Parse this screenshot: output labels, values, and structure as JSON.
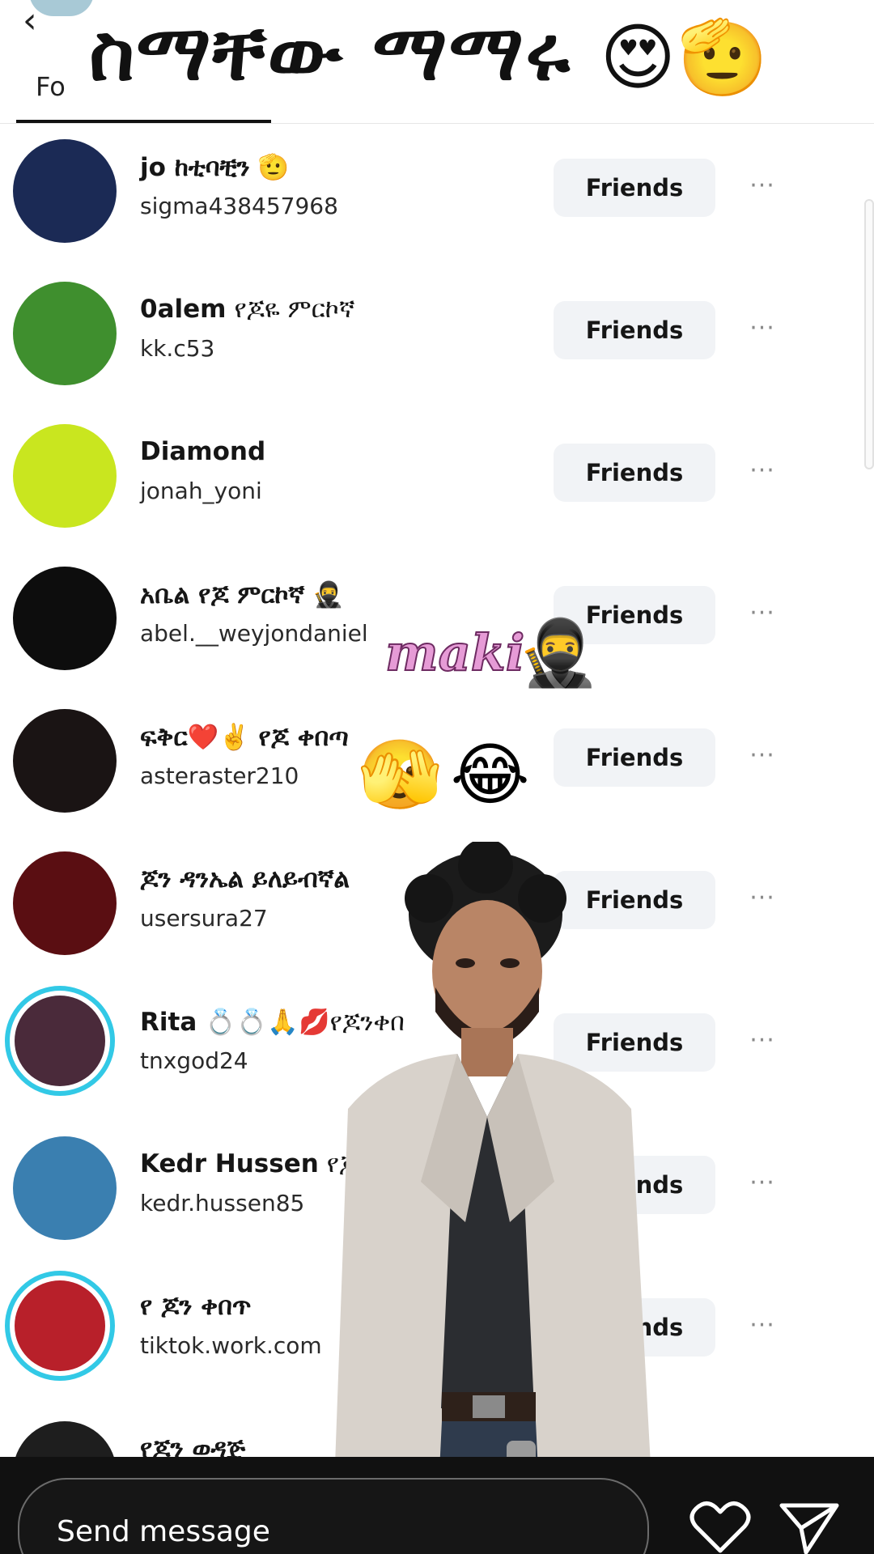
{
  "header": {
    "tab_label": "Fo",
    "overlay_title": "ስማቸው ማማሩ",
    "title_emojis": "😍🫡"
  },
  "overlays": {
    "maki_text": "maki",
    "maki_emoji": "🥷",
    "reaction_emojis": "🫣😂"
  },
  "friend_button_label": "Friends",
  "more_label": "···",
  "friends": [
    {
      "name": "jo ከቲባቺን",
      "emoji": "🫡",
      "username": "sigma438457968",
      "avatar_color": "#1b2a55",
      "ring": false
    },
    {
      "name": "0alem",
      "suffix": "የጆዬ ምርኮኛ",
      "username": "kk.c53",
      "avatar_color": "#3f8f2e",
      "ring": false
    },
    {
      "name": "Diamond",
      "username": "jonah_yoni",
      "avatar_color": "#c9e61f",
      "ring": false
    },
    {
      "name": "አቤል የጆ ምርኮኛ",
      "emoji": "🥷",
      "username": "abel.__weyjondaniel",
      "avatar_color": "#0d0d0d",
      "ring": false
    },
    {
      "name": "ፍቅር❤️✌️ የጆ ቀበጣ",
      "username": "asteraster210",
      "avatar_color": "#1a1414",
      "ring": false
    },
    {
      "name": "ጆን ዳንኤል ይለይብኛል",
      "username": "usersura27",
      "avatar_color": "#5a0e12",
      "ring": false
    },
    {
      "name": "Rita",
      "suffix": "💍💍🙏💋የጆንቀበ",
      "username": "tnxgod24",
      "avatar_color": "#4a2a3a",
      "ring": true
    },
    {
      "name": "Kedr Hussen",
      "suffix": "የጆ",
      "username": "kedr.hussen85",
      "avatar_color": "#3a7fb0",
      "ring": false
    },
    {
      "name": "የ ጆን ቀበጥ",
      "username": "tiktok.work.com",
      "avatar_color": "#b8202a",
      "ring": true
    },
    {
      "name": "የጆን ወዳጅ",
      "username": "",
      "avatar_color": "#1e1e1e",
      "ring": false
    }
  ],
  "bottom_bar": {
    "send_placeholder": "Send message"
  },
  "icons": {
    "heart": "heart-icon",
    "share": "send-icon",
    "back": "chevron-left-icon",
    "more": "more-dots-icon"
  },
  "colors": {
    "ring": "#32c9e6",
    "button_bg": "#f1f3f6",
    "bottom_bar": "#111111"
  }
}
